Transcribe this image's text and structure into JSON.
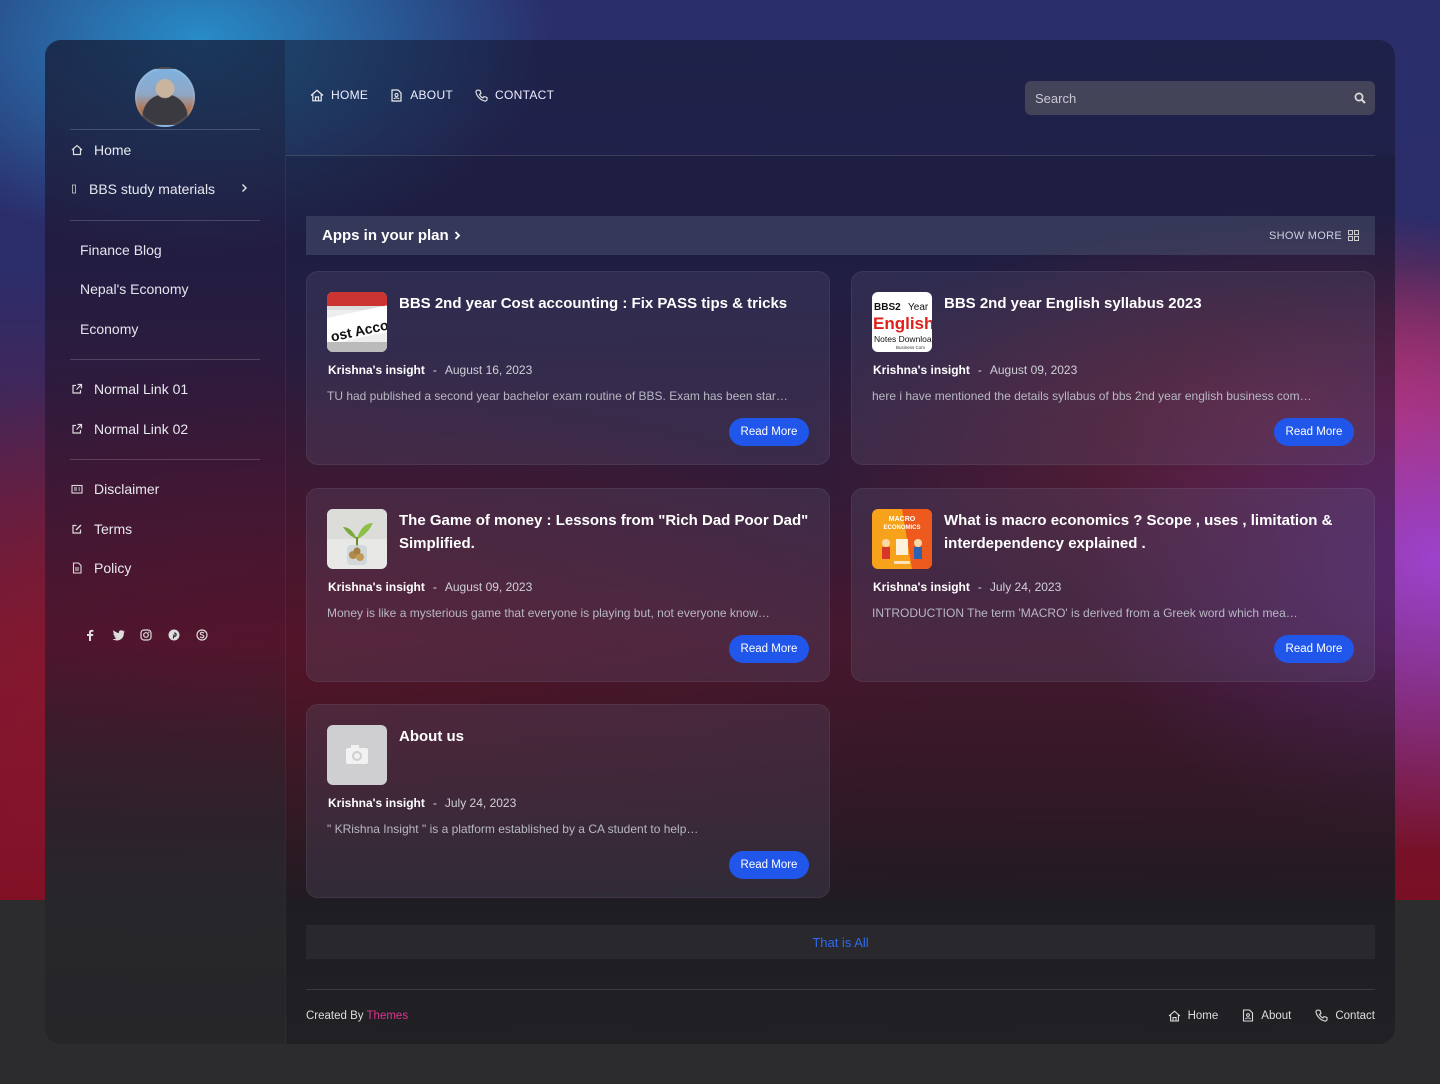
{
  "nav": {
    "top": [
      {
        "label": "HOME",
        "icon": "home-icon"
      },
      {
        "label": "ABOUT",
        "icon": "about-icon"
      },
      {
        "label": "CONTACT",
        "icon": "phone-icon"
      }
    ],
    "search_placeholder": "Search"
  },
  "sidebar": {
    "home": "Home",
    "bbs": "BBS study materials",
    "sub": [
      "Finance Blog",
      "Nepal's Economy",
      "Economy"
    ],
    "links": [
      "Normal Link 01",
      "Normal Link 02"
    ],
    "pages": [
      "Disclaimer",
      "Terms",
      "Policy"
    ],
    "social_icons": [
      "facebook-icon",
      "twitter-icon",
      "instagram-icon",
      "pinterest-icon",
      "skype-icon"
    ]
  },
  "section": {
    "title": "Apps in your plan",
    "show_more": "SHOW MORE"
  },
  "posts": [
    {
      "title": "BBS 2nd year Cost accounting : Fix PASS tips & tricks",
      "author": "Krishna's insight",
      "date": "August 16, 2023",
      "snippet": "TU had published a second year bachelor exam routine of BBS. Exam has been star…",
      "thumb": "cost-accounting",
      "button": "Read More"
    },
    {
      "title": "BBS 2nd year English syllabus 2023",
      "author": "Krishna's insight",
      "date": "August 09, 2023",
      "snippet": "here i have mentioned the details syllabus of bbs 2nd year english business com…",
      "thumb": "english",
      "thumb_text": [
        "BBS2",
        "Year",
        "English",
        "Notes Download",
        "Business Com"
      ],
      "button": "Read More"
    },
    {
      "title": "The Game of money : Lessons from \"Rich Dad Poor Dad\" Simplified.",
      "author": "Krishna's insight",
      "date": "August 09, 2023",
      "snippet": "Money is like a mysterious game that everyone is playing but, not everyone know…",
      "thumb": "money-plant",
      "button": "Read More"
    },
    {
      "title": "What is macro economics ? Scope , uses , limitation & interdependency explained .",
      "author": "Krishna's insight",
      "date": "July 24, 2023",
      "snippet": "INTRODUCTION The term  'MACRO' is derived from a Greek word which mea…",
      "thumb": "macro",
      "thumb_text": [
        "MACRO",
        "ECONOMICS"
      ],
      "button": "Read More"
    },
    {
      "title": "About us",
      "author": "Krishna's insight",
      "date": "July 24, 2023",
      "snippet": "\" KRishna Insight \" is a platform established by a CA student to help…",
      "thumb": "placeholder",
      "button": "Read More"
    }
  ],
  "footer": {
    "that_is_all": "That is All",
    "created_by": "Created By",
    "themes": "Themes",
    "links": [
      "Home",
      "About",
      "Contact"
    ]
  },
  "colors": {
    "accent": "#2056ea",
    "brand_pink": "#e0358f",
    "link_blue": "#2f6bf0"
  }
}
